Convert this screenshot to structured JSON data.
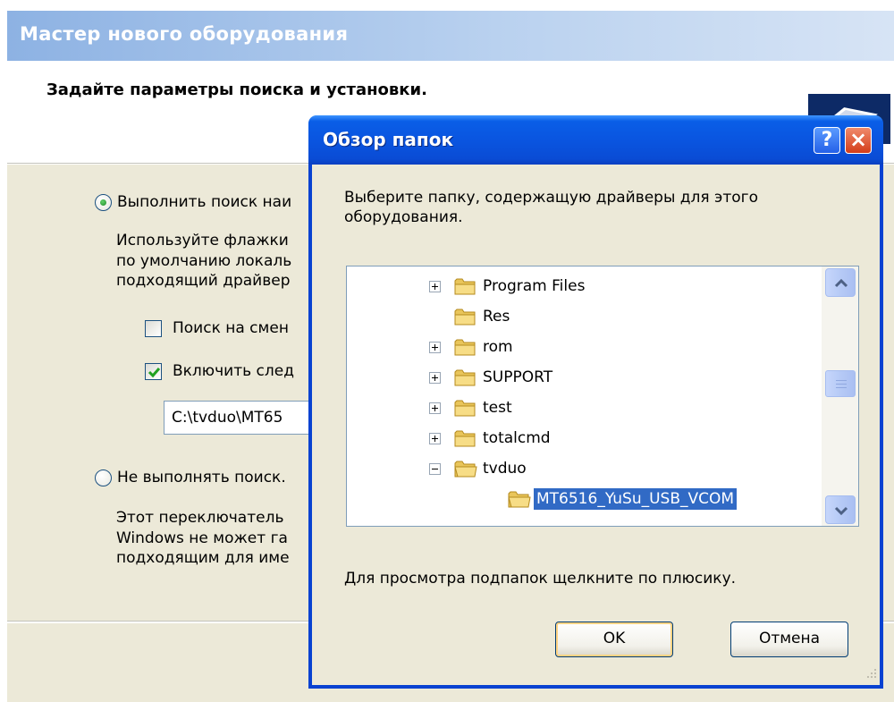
{
  "wizard": {
    "title": "Мастер нового оборудования",
    "heading": "Задайте параметры поиска и установки.",
    "option_search": {
      "label": "Выполнить поиск наи",
      "selected": true,
      "description": [
        "Используйте флажки",
        "по умолчанию локаль",
        "подходящий драйвер"
      ]
    },
    "checkbox_removable": {
      "label": "Поиск на смен",
      "checked": false
    },
    "checkbox_include": {
      "label": "Включить след",
      "checked": true
    },
    "path_value": "C:\\tvduo\\MT65",
    "option_manual": {
      "label": "Не выполнять поиск.",
      "selected": false,
      "description": [
        "Этот переключатель",
        "Windows не может га",
        "подходящим для име"
      ]
    }
  },
  "dialog": {
    "title": "Обзор папок",
    "help_button": "?",
    "close_button": "×",
    "instruction": "Выберите папку, содержащую драйверы для этого оборудования.",
    "tree": [
      {
        "label": "Program Files",
        "expander": "plus",
        "level": 0
      },
      {
        "label": "Res",
        "expander": "none",
        "level": 0
      },
      {
        "label": "rom",
        "expander": "plus",
        "level": 0
      },
      {
        "label": "SUPPORT",
        "expander": "plus",
        "level": 0
      },
      {
        "label": "test",
        "expander": "plus",
        "level": 0
      },
      {
        "label": "totalcmd",
        "expander": "plus",
        "level": 0
      },
      {
        "label": "tvduo",
        "expander": "minus",
        "level": 0
      },
      {
        "label": "MT6516_YuSu_USB_VCOM",
        "expander": "none",
        "level": 1,
        "selected": true
      }
    ],
    "hint": "Для просмотра подпапок щелкните по плюсику.",
    "ok_label": "OK",
    "cancel_label": "Отмена"
  },
  "colors": {
    "title_bar_blue": "#0a55e0",
    "selection": "#316ac5",
    "folder_yellow": "#f4d77c",
    "dialog_face": "#ece9d8"
  }
}
